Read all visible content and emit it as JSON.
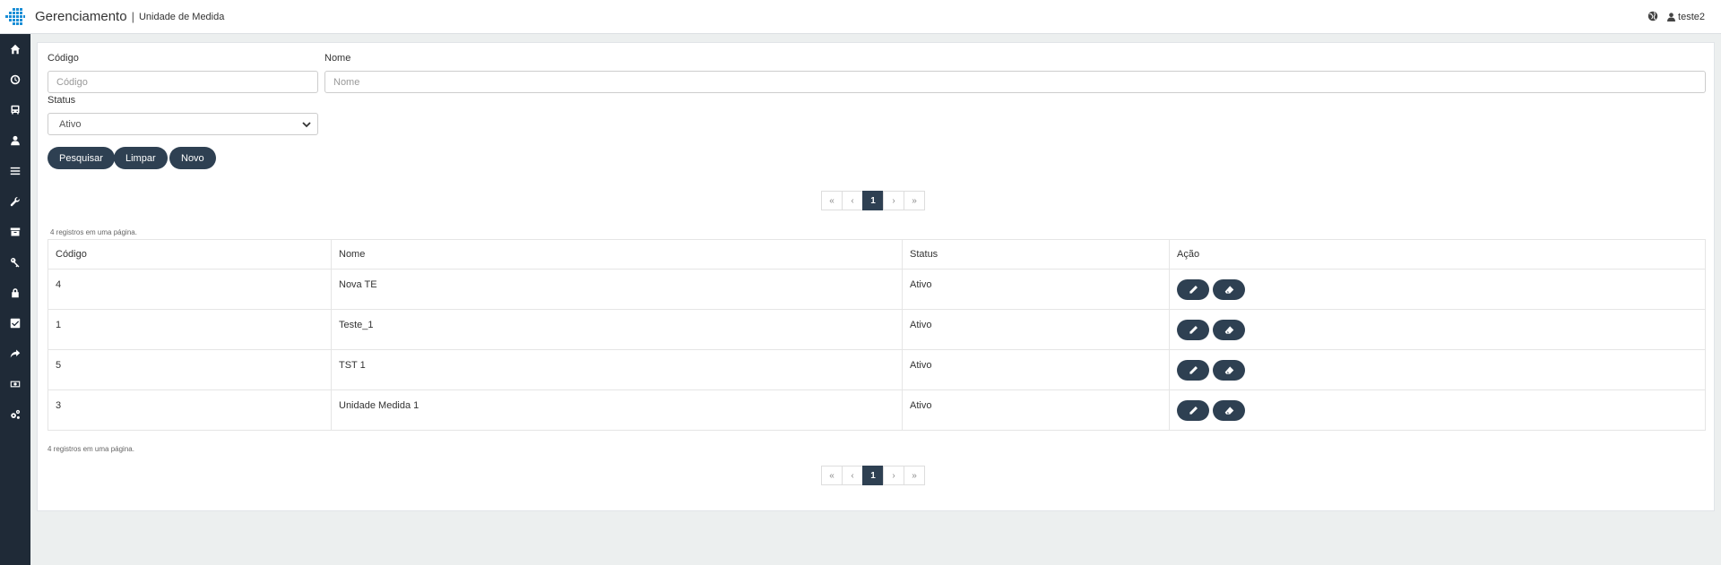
{
  "header": {
    "app_title": "Gerenciamento",
    "separator": "|",
    "subtitle": "Unidade de Medida",
    "username": "teste2"
  },
  "sidebar": {
    "items": [
      {
        "icon": "home-icon"
      },
      {
        "icon": "clock-icon"
      },
      {
        "icon": "bus-icon"
      },
      {
        "icon": "user-icon"
      },
      {
        "icon": "list-icon"
      },
      {
        "icon": "wrench-icon"
      },
      {
        "icon": "archive-icon"
      },
      {
        "icon": "key-icon"
      },
      {
        "icon": "lock-icon"
      },
      {
        "icon": "checkbox-icon"
      },
      {
        "icon": "share-icon"
      },
      {
        "icon": "money-icon"
      },
      {
        "icon": "cogs-icon"
      }
    ]
  },
  "form": {
    "codigo_label": "Código",
    "codigo_placeholder": "Código",
    "codigo_value": "",
    "nome_label": "Nome",
    "nome_placeholder": "Nome",
    "nome_value": "",
    "status_label": "Status",
    "status_selected": "Ativo"
  },
  "buttons": {
    "search": "Pesquisar",
    "clear": "Limpar",
    "new": "Novo"
  },
  "pagination": {
    "first": "«",
    "prev": "‹",
    "current": "1",
    "next": "›",
    "last": "»"
  },
  "records_info": "4 registros em uma página.",
  "table": {
    "headers": [
      "Código",
      "Nome",
      "Status",
      "Ação"
    ],
    "rows": [
      {
        "codigo": "4",
        "nome": "Nova TE",
        "status": "Ativo"
      },
      {
        "codigo": "1",
        "nome": "Teste_1",
        "status": "Ativo"
      },
      {
        "codigo": "5",
        "nome": "TST 1",
        "status": "Ativo"
      },
      {
        "codigo": "3",
        "nome": "Unidade Medida 1",
        "status": "Ativo"
      }
    ]
  },
  "colors": {
    "sidebar_bg": "#1f2a37",
    "button_bg": "#2e4052",
    "page_bg": "#ecefef"
  }
}
